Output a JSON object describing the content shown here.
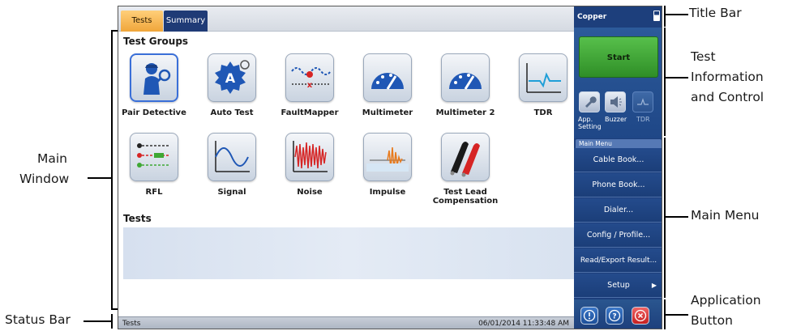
{
  "tabs": {
    "tests": "Tests",
    "summary": "Summary"
  },
  "sections": {
    "test_groups": "Test Groups",
    "tests": "Tests"
  },
  "test_groups": [
    {
      "label": "Pair Detective",
      "icon": "pair-detective-icon",
      "selected": true
    },
    {
      "label": "Auto Test",
      "icon": "auto-test-icon"
    },
    {
      "label": "FaultMapper",
      "icon": "faultmapper-icon"
    },
    {
      "label": "Multimeter",
      "icon": "multimeter-icon"
    },
    {
      "label": "Multimeter 2",
      "icon": "multimeter-icon"
    },
    {
      "label": "TDR",
      "icon": "tdr-icon"
    },
    {
      "label": "RFL",
      "icon": "rfl-icon"
    },
    {
      "label": "Signal",
      "icon": "signal-icon"
    },
    {
      "label": "Noise",
      "icon": "noise-icon"
    },
    {
      "label": "Impulse",
      "icon": "impulse-icon"
    },
    {
      "label": "Test Lead Compensation",
      "icon": "test-leads-icon"
    }
  ],
  "status_bar": {
    "left": "Tests",
    "datetime": "06/01/2014 11:33:48 AM"
  },
  "title_bar": {
    "title": "Copper"
  },
  "control": {
    "start": "Start",
    "app_setting": "App. Setting",
    "buzzer": "Buzzer",
    "tdr": "TDR"
  },
  "main_menu": {
    "header": "Main Menu",
    "items": [
      "Cable Book...",
      "Phone Book...",
      "Dialer...",
      "Config / Profile...",
      "Read/Export Result...",
      "Setup"
    ]
  },
  "callouts": {
    "title_bar": "Title Bar",
    "test_info_1": "Test",
    "test_info_2": "Information",
    "test_info_3": "and Control",
    "main_menu": "Main Menu",
    "app_button_1": "Application",
    "app_button_2": "Button",
    "main_window_1": "Main",
    "main_window_2": "Window",
    "status_bar": "Status Bar"
  },
  "colors": {
    "accent_blue": "#1d3f7c",
    "start_green": "#3fa834",
    "tab_orange": "#f0a63a",
    "close_red": "#d93030"
  }
}
